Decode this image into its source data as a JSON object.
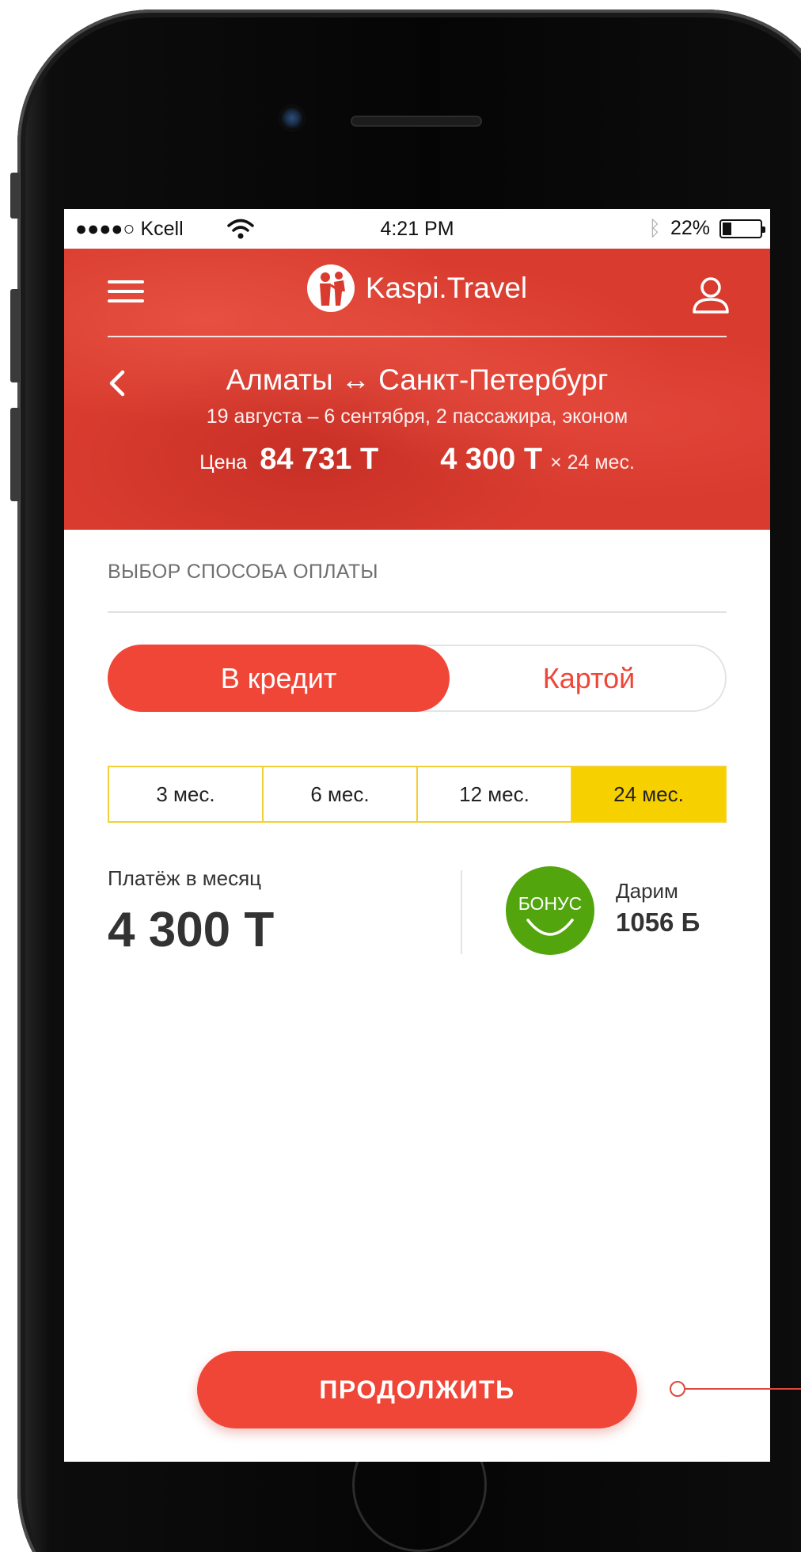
{
  "colors": {
    "brand_red": "#f04637",
    "header_red": "#d93c2f",
    "term_highlight": "#f7d000",
    "bonus_green": "#53a50e"
  },
  "status_bar": {
    "carrier": "●●●●○ Kcell",
    "time": "4:21 PM",
    "bluetooth_icon": "bluetooth-icon",
    "battery_percent": "22%",
    "battery_level": 0.22
  },
  "header": {
    "menu_icon": "hamburger-menu-icon",
    "brand_name": "Kaspi.Travel",
    "profile_icon": "user-icon",
    "back_icon": "chevron-left-icon",
    "route": "Алматы ↔ Санкт-Петербург",
    "trip_info": "19 августа – 6 сентября, 2 пассажира, эконом",
    "price_label": "Цена",
    "price_total": "84 731 Т",
    "price_monthly": "4 300 Т",
    "price_term": "× 24 мес."
  },
  "payment": {
    "section_title": "ВЫБОР СПОСОБА ОПЛАТЫ",
    "methods": [
      "В кредит",
      "Картой"
    ],
    "selected_method": "В кредит",
    "terms": [
      {
        "label": "3 мес.",
        "active": false
      },
      {
        "label": "6 мес.",
        "active": false
      },
      {
        "label": "12 мес.",
        "active": false
      },
      {
        "label": "24 мес.",
        "active": true
      }
    ],
    "monthly_label": "Платёж в месяц",
    "monthly_amount": "4 300 Т",
    "bonus_badge_text": "БОНУС",
    "gift_label": "Дарим",
    "gift_amount": "1056 Б"
  },
  "actions": {
    "continue_label": "ПРОДОЛЖИТЬ"
  }
}
